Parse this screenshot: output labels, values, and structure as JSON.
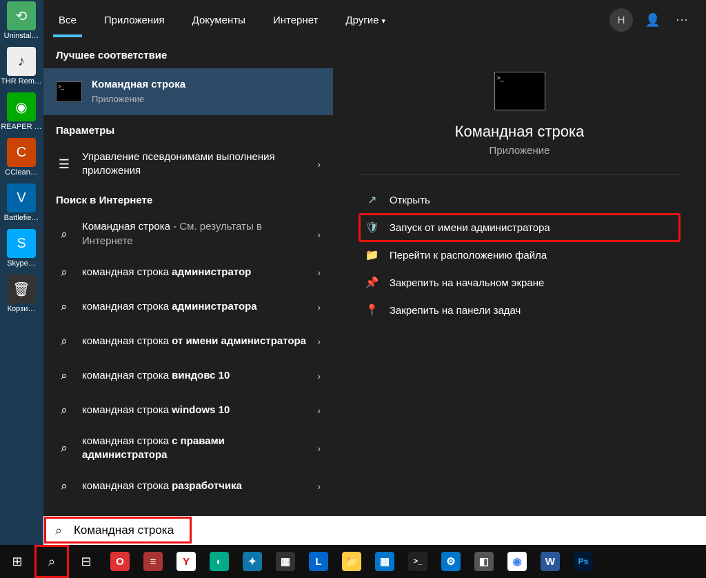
{
  "desktop": {
    "items": [
      {
        "label": "Uninstal…",
        "color": "#4a6"
      },
      {
        "label": "THR Rem…",
        "color": "#eee"
      },
      {
        "label": "REAPER …",
        "color": "#0a0"
      },
      {
        "label": "CClean…",
        "color": "#c40"
      },
      {
        "label": "Battlefie…",
        "color": "#06a"
      },
      {
        "label": "Skype…",
        "color": "#0af"
      },
      {
        "label": "Корзи…",
        "color": "#333"
      }
    ]
  },
  "tabs": {
    "items": [
      "Все",
      "Приложения",
      "Документы",
      "Интернет",
      "Другие"
    ],
    "avatar": "Н"
  },
  "sections": {
    "best": "Лучшее соответствие",
    "params": "Параметры",
    "web": "Поиск в Интернете"
  },
  "best_match": {
    "title": "Командная строка",
    "subtitle": "Приложение"
  },
  "params_items": [
    {
      "title": "Управление псевдонимами выполнения приложения"
    }
  ],
  "web_items": [
    {
      "prefix": "Командная строка",
      "suffix": " - См. результаты в Интернете",
      "bold": ""
    },
    {
      "prefix": "командная строка ",
      "bold": "администратор"
    },
    {
      "prefix": "командная строка ",
      "bold": "администратора"
    },
    {
      "prefix": "командная строка ",
      "bold": "от имени администратора"
    },
    {
      "prefix": "командная строка ",
      "bold": "виндовс 10"
    },
    {
      "prefix": "командная строка ",
      "bold": "windows 10"
    },
    {
      "prefix": "командная строка ",
      "bold": "с правами администратора"
    },
    {
      "prefix": "командная строка ",
      "bold": "разработчика"
    }
  ],
  "preview": {
    "title": "Командная строка",
    "subtitle": "Приложение",
    "actions": [
      {
        "icon": "↗",
        "label": "Открыть"
      },
      {
        "icon": "🛡",
        "label": "Запуск от имени администратора",
        "highlight": true
      },
      {
        "icon": "📁",
        "label": "Перейти к расположению файла"
      },
      {
        "icon": "📌",
        "label": "Закрепить на начальном экране"
      },
      {
        "icon": "📍",
        "label": "Закрепить на панели задач"
      }
    ]
  },
  "search": {
    "value": "Командная строка"
  },
  "taskbar": {
    "apps": [
      {
        "name": "opera",
        "bg": "#d33",
        "txt": "O"
      },
      {
        "name": "app1",
        "bg": "#a33",
        "txt": "≡"
      },
      {
        "name": "yandex",
        "bg": "#fff",
        "txt": "Y",
        "fg": "#d00"
      },
      {
        "name": "browser",
        "bg": "#0a8",
        "txt": "◐"
      },
      {
        "name": "app2",
        "bg": "#17a",
        "txt": "✦"
      },
      {
        "name": "app3",
        "bg": "#333",
        "txt": "▦"
      },
      {
        "name": "app4",
        "bg": "#06c",
        "txt": "L"
      },
      {
        "name": "explorer",
        "bg": "#fc4",
        "txt": "📁"
      },
      {
        "name": "calc",
        "bg": "#07c",
        "txt": "▦"
      },
      {
        "name": "terminal",
        "bg": "#222",
        "txt": ">_"
      },
      {
        "name": "settings",
        "bg": "#07c",
        "txt": "⚙"
      },
      {
        "name": "app5",
        "bg": "#555",
        "txt": "◧"
      },
      {
        "name": "chrome",
        "bg": "#fff",
        "txt": "◉",
        "fg": "#4285f4"
      },
      {
        "name": "word",
        "bg": "#2b579a",
        "txt": "W"
      },
      {
        "name": "photoshop",
        "bg": "#001833",
        "txt": "Ps",
        "fg": "#31a8ff"
      }
    ]
  }
}
